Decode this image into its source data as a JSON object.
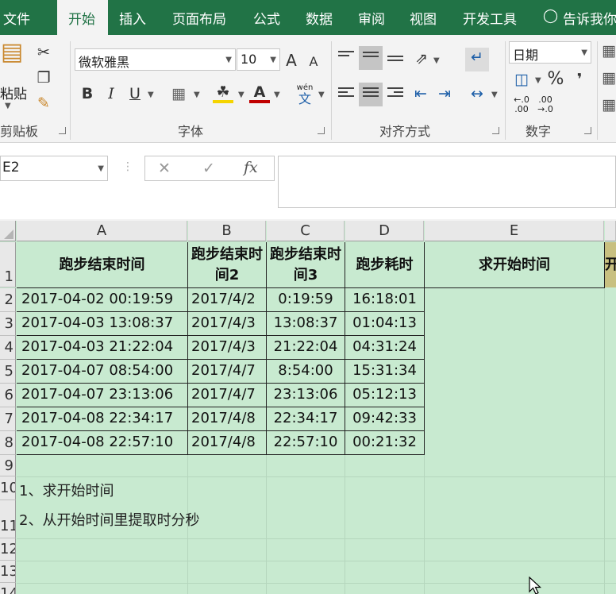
{
  "tabs": [
    "文件",
    "开始",
    "插入",
    "页面布局",
    "公式",
    "数据",
    "审阅",
    "视图",
    "开发工具"
  ],
  "tell_me": "告诉我你",
  "ribbon": {
    "clipboard": {
      "paste": "粘贴",
      "label": "剪贴板"
    },
    "font": {
      "name": "微软雅黑",
      "size": "10",
      "bold": "B",
      "italic": "I",
      "underline": "U",
      "grow": "A",
      "shrink": "A",
      "label": "字体",
      "phonetic_top": "wén",
      "phonetic_bottom": "文"
    },
    "alignment": {
      "label": "对齐方式"
    },
    "number": {
      "format": "日期",
      "percent": "%",
      "comma": "❜",
      "inc_top": "←.0",
      "inc_bottom": ".00",
      "dec_top": ".00",
      "dec_bottom": "→.0",
      "label": "数字"
    }
  },
  "formula_bar": {
    "name_box": "E2",
    "cancel": "✕",
    "enter": "✓",
    "fx": "fx",
    "value": ""
  },
  "columns": [
    "A",
    "B",
    "C",
    "D",
    "E"
  ],
  "rows": [
    "1",
    "2",
    "3",
    "4",
    "5",
    "6",
    "7",
    "8",
    "9",
    "10",
    "11",
    "12",
    "13",
    "14"
  ],
  "headers": [
    "跑步结束时间",
    "跑步结束时间2",
    "跑步结束时间3",
    "跑步耗时",
    "求开始时间",
    "开"
  ],
  "table": [
    [
      "2017-04-02 00:19:59",
      "2017/4/2",
      "0:19:59",
      "16:18:01",
      ""
    ],
    [
      "2017-04-03 13:08:37",
      "2017/4/3",
      "13:08:37",
      "01:04:13",
      ""
    ],
    [
      "2017-04-03 21:22:04",
      "2017/4/3",
      "21:22:04",
      "04:31:24",
      ""
    ],
    [
      "2017-04-07 08:54:00",
      "2017/4/7",
      "8:54:00",
      "15:31:34",
      ""
    ],
    [
      "2017-04-07 23:13:06",
      "2017/4/7",
      "23:13:06",
      "05:12:13",
      ""
    ],
    [
      "2017-04-08 22:34:17",
      "2017/4/8",
      "22:34:17",
      "09:42:33",
      ""
    ],
    [
      "2017-04-08 22:57:10",
      "2017/4/8",
      "22:57:10",
      "00:21:32",
      ""
    ]
  ],
  "notes": [
    "1、求开始时间",
    "2、从开始时间里提取时分秒"
  ],
  "colors": {
    "excel_green": "#217346",
    "cell_fill": "#c8ead0",
    "col_f_fill": "#c8c080"
  }
}
